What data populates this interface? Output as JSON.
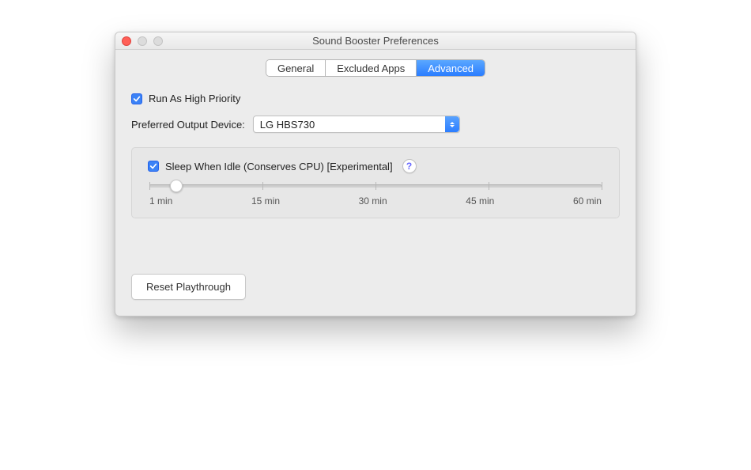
{
  "window": {
    "title": "Sound Booster Preferences"
  },
  "tabs": {
    "items": [
      "General",
      "Excluded Apps",
      "Advanced"
    ],
    "active_index": 2
  },
  "high_priority": {
    "checked": true,
    "label": "Run As High Priority"
  },
  "output_device": {
    "label": "Preferred Output Device:",
    "selected": "LG HBS730"
  },
  "sleep": {
    "checked": true,
    "label": "Sleep When Idle (Conserves CPU) [Experimental]",
    "help_char": "?",
    "scale": [
      "1 min",
      "15 min",
      "30 min",
      "45 min",
      "60 min"
    ],
    "value_percent": 6
  },
  "reset": {
    "label": "Reset Playthrough"
  },
  "colors": {
    "accent": "#2a7dff"
  }
}
